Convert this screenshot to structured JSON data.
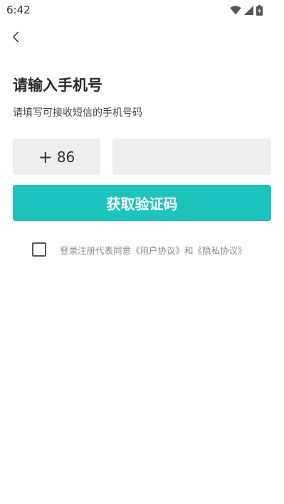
{
  "status_bar": {
    "time": "6:42",
    "icons": [
      "wifi-icon",
      "signal-icon",
      "battery-icon"
    ]
  },
  "header": {
    "back_icon": "chevron-left-icon"
  },
  "page": {
    "title": "请输入手机号",
    "subtitle": "请填写可接收短信的手机号码"
  },
  "form": {
    "country_code_plus": "+",
    "country_code": "86",
    "phone_value": "",
    "get_code_label": "获取验证码",
    "button_color": "#1ec3bd"
  },
  "agreement": {
    "checked": false,
    "prefix": "登录注册代表同意",
    "user_agreement": "《用户协议》",
    "conjunction": "和",
    "privacy_agreement": "《隐私协议》"
  }
}
